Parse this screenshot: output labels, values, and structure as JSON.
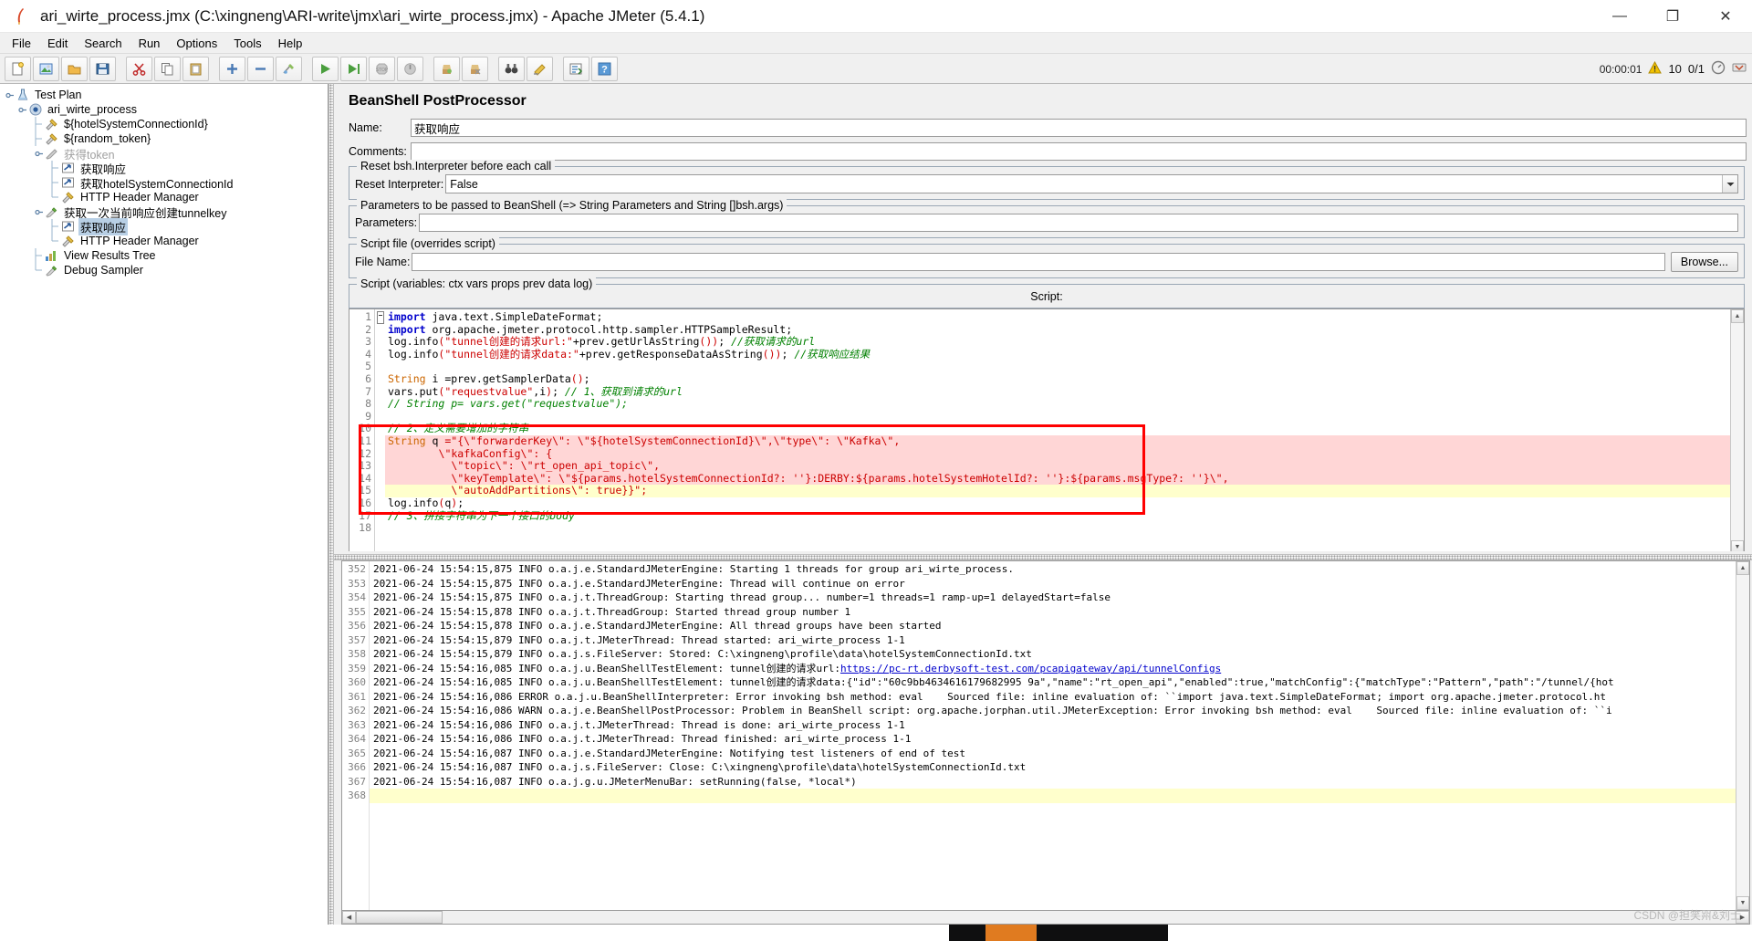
{
  "window": {
    "title": "ari_wirte_process.jmx (C:\\xingneng\\ARI-write\\jmx\\ari_wirte_process.jmx) - Apache JMeter (5.4.1)",
    "app_icon": "jmeter-feather-icon",
    "minimize_label": "—",
    "maximize_label": "❐",
    "close_label": "✕"
  },
  "menu": {
    "items": [
      {
        "label": "File",
        "mnemonic": "F"
      },
      {
        "label": "Edit",
        "mnemonic": "E"
      },
      {
        "label": "Search",
        "mnemonic": "S"
      },
      {
        "label": "Run",
        "mnemonic": "R"
      },
      {
        "label": "Options",
        "mnemonic": "O"
      },
      {
        "label": "Tools",
        "mnemonic": "T"
      },
      {
        "label": "Help",
        "mnemonic": "H"
      }
    ]
  },
  "toolbar": {
    "buttons": [
      {
        "name": "new-button",
        "icon": "new-document-icon",
        "tip": "New"
      },
      {
        "name": "templates-button",
        "icon": "templates-icon",
        "tip": "Templates"
      },
      {
        "name": "open-button",
        "icon": "open-folder-icon",
        "tip": "Open"
      },
      {
        "name": "save-button",
        "icon": "save-disk-icon",
        "tip": "Save"
      },
      {
        "name": "cut-button",
        "icon": "cut-scissors-icon",
        "tip": "Cut"
      },
      {
        "name": "copy-button",
        "icon": "copy-icon",
        "tip": "Copy"
      },
      {
        "name": "paste-button",
        "icon": "paste-clipboard-icon",
        "tip": "Paste"
      },
      {
        "name": "expand-all-button",
        "icon": "plus-expand-icon",
        "tip": "Expand All"
      },
      {
        "name": "collapse-all-button",
        "icon": "minus-collapse-icon",
        "tip": "Collapse All"
      },
      {
        "name": "toggle-button",
        "icon": "toggle-wand-icon",
        "tip": "Toggle"
      },
      {
        "name": "start-button",
        "icon": "play-green-icon",
        "tip": "Start"
      },
      {
        "name": "start-no-pauses-button",
        "icon": "play-no-pause-icon",
        "tip": "Start no pauses"
      },
      {
        "name": "stop-button",
        "icon": "stop-octagon-icon",
        "tip": "Stop"
      },
      {
        "name": "shutdown-button",
        "icon": "shutdown-icon",
        "tip": "Shutdown"
      },
      {
        "name": "clear-button",
        "icon": "clear-broom-icon",
        "tip": "Clear"
      },
      {
        "name": "clear-all-button",
        "icon": "clear-all-icon",
        "tip": "Clear All"
      },
      {
        "name": "search-button",
        "icon": "binoculars-search-icon",
        "tip": "Search"
      },
      {
        "name": "reset-search-button",
        "icon": "reset-search-icon",
        "tip": "Reset Search"
      },
      {
        "name": "function-helper-button",
        "icon": "function-helper-icon",
        "tip": "Function Helper Dialog"
      },
      {
        "name": "help-button",
        "icon": "help-question-icon",
        "tip": "Help"
      }
    ],
    "elapsed_time": "00:00:01",
    "warning_icon": "warning-triangle-icon",
    "warning_count": "10",
    "threads_active": "0/1",
    "threads_icon": "threads-gauge-icon",
    "remote_icon": "remote-engine-icon"
  },
  "tree": {
    "nodes": [
      {
        "label": "Test Plan",
        "icon": "beaker-icon",
        "depth": 0,
        "handle": "expanded",
        "selected": false,
        "dim": false
      },
      {
        "label": "ari_wirte_process",
        "icon": "thread-group-icon",
        "depth": 1,
        "handle": "expanded",
        "selected": false,
        "dim": false
      },
      {
        "label": "${hotelSystemConnectionId}",
        "icon": "config-wrench-icon",
        "depth": 2,
        "handle": "leaf",
        "selected": false,
        "dim": false
      },
      {
        "label": "${random_token}",
        "icon": "config-wrench-icon",
        "depth": 2,
        "handle": "leaf",
        "selected": false,
        "dim": false
      },
      {
        "label": "获得token",
        "icon": "sampler-pen-icon",
        "depth": 2,
        "handle": "expanded",
        "selected": false,
        "dim": true
      },
      {
        "label": "获取响应",
        "icon": "postprocessor-arrow-icon",
        "depth": 3,
        "handle": "leaf",
        "selected": false,
        "dim": false
      },
      {
        "label": "获取hotelSystemConnectionId",
        "icon": "postprocessor-arrow-icon",
        "depth": 3,
        "handle": "leaf",
        "selected": false,
        "dim": false
      },
      {
        "label": "HTTP Header Manager",
        "icon": "config-wrench-icon",
        "depth": 3,
        "handle": "leaf-last",
        "selected": false,
        "dim": false
      },
      {
        "label": "获取一次当前响应创建tunnelkey",
        "icon": "sampler-pen-green-icon",
        "depth": 2,
        "handle": "expanded",
        "selected": false,
        "dim": false
      },
      {
        "label": "获取响应",
        "icon": "postprocessor-arrow-icon",
        "depth": 3,
        "handle": "leaf",
        "selected": true,
        "dim": false
      },
      {
        "label": "HTTP Header Manager",
        "icon": "config-wrench-icon",
        "depth": 3,
        "handle": "leaf-last",
        "selected": false,
        "dim": false
      },
      {
        "label": "View Results Tree",
        "icon": "listener-chart-icon",
        "depth": 2,
        "handle": "leaf",
        "selected": false,
        "dim": false
      },
      {
        "label": "Debug Sampler",
        "icon": "sampler-pen-green-icon",
        "depth": 2,
        "handle": "leaf-last",
        "selected": false,
        "dim": false
      }
    ]
  },
  "editor": {
    "panel_title": "BeanShell PostProcessor",
    "name_label": "Name:",
    "name_value": "获取响应",
    "comments_label": "Comments:",
    "comments_value": "",
    "reset_fieldset_legend": "Reset bsh.Interpreter before each call",
    "reset_label": "Reset Interpreter:",
    "reset_value": "False",
    "reset_options": [
      "False",
      "True"
    ],
    "params_fieldset_legend": "Parameters to be passed to BeanShell (=> String Parameters and String []bsh.args)",
    "params_label": "Parameters:",
    "params_value": "",
    "scriptfile_fieldset_legend": "Script file (overrides script)",
    "filename_label": "File Name:",
    "filename_value": "",
    "browse_label": "Browse...",
    "script_fieldset_legend": "Script (variables: ctx vars props prev data log)",
    "script_center_label": "Script:"
  },
  "script": {
    "lines": [
      {
        "n": 1,
        "fold": true,
        "hl": "none",
        "text": "import java.text.SimpleDateFormat;"
      },
      {
        "n": 2,
        "fold": false,
        "hl": "none",
        "text": "import org.apache.jmeter.protocol.http.sampler.HTTPSampleResult;"
      },
      {
        "n": 3,
        "fold": false,
        "hl": "none",
        "text": "log.info(\"tunnel创建的请求url:\"+prev.getUrlAsString()); //获取请求的url"
      },
      {
        "n": 4,
        "fold": false,
        "hl": "none",
        "text": "log.info(\"tunnel创建的请求data:\"+prev.getResponseDataAsString()); //获取响应结果"
      },
      {
        "n": 5,
        "fold": false,
        "hl": "none",
        "text": ""
      },
      {
        "n": 6,
        "fold": false,
        "hl": "none",
        "text": "String i =prev.getSamplerData();"
      },
      {
        "n": 7,
        "fold": false,
        "hl": "none",
        "text": "vars.put(\"requestvalue\",i); // 1、获取到请求的url"
      },
      {
        "n": 8,
        "fold": false,
        "hl": "none",
        "text": "// String p= vars.get(\"requestvalue\");"
      },
      {
        "n": 9,
        "fold": false,
        "hl": "none",
        "text": ""
      },
      {
        "n": 10,
        "fold": false,
        "hl": "none",
        "text": "// 2、定义需要增加的字符串"
      },
      {
        "n": 11,
        "fold": false,
        "hl": "pink",
        "text": "String q =\"{\\\"forwarderKey\\\": \\\"${hotelSystemConnectionId}\\\",\\\"type\\\": \\\"Kafka\\\","
      },
      {
        "n": 12,
        "fold": false,
        "hl": "pink",
        "text": "        \\\"kafkaConfig\\\": {"
      },
      {
        "n": 13,
        "fold": false,
        "hl": "pink",
        "text": "          \\\"topic\\\": \\\"rt_open_api_topic\\\","
      },
      {
        "n": 14,
        "fold": false,
        "hl": "pink",
        "text": "          \\\"keyTemplate\\\": \\\"${params.hotelSystemConnectionId?: ''}:DERBY:${params.hotelSystemHotelId?: ''}:${params.msgType?: ''}\\\","
      },
      {
        "n": 15,
        "fold": false,
        "hl": "yellow",
        "text": "          \\\"autoAddPartitions\\\": true}}\";"
      },
      {
        "n": 16,
        "fold": false,
        "hl": "none",
        "text": "log.info(q);"
      },
      {
        "n": 17,
        "fold": false,
        "hl": "none",
        "text": "// 3、拼接字符串为下一个接口的body"
      },
      {
        "n": 18,
        "fold": false,
        "hl": "none",
        "text": ""
      }
    ],
    "redbox_note": "red annotation rectangle around lines 10-16"
  },
  "log": {
    "lines": [
      {
        "n": 352,
        "text": "2021-06-24 15:54:15,875 INFO o.a.j.e.StandardJMeterEngine: Starting 1 threads for group ari_wirte_process.",
        "cur": false,
        "clipped_top": true
      },
      {
        "n": 353,
        "text": "2021-06-24 15:54:15,875 INFO o.a.j.e.StandardJMeterEngine: Thread will continue on error",
        "cur": false
      },
      {
        "n": 354,
        "text": "2021-06-24 15:54:15,875 INFO o.a.j.t.ThreadGroup: Starting thread group... number=1 threads=1 ramp-up=1 delayedStart=false",
        "cur": false
      },
      {
        "n": 355,
        "text": "2021-06-24 15:54:15,878 INFO o.a.j.t.ThreadGroup: Started thread group number 1",
        "cur": false
      },
      {
        "n": 356,
        "text": "2021-06-24 15:54:15,878 INFO o.a.j.e.StandardJMeterEngine: All thread groups have been started",
        "cur": false
      },
      {
        "n": 357,
        "text": "2021-06-24 15:54:15,879 INFO o.a.j.t.JMeterThread: Thread started: ari_wirte_process 1-1",
        "cur": false
      },
      {
        "n": 358,
        "text": "2021-06-24 15:54:15,879 INFO o.a.j.s.FileServer: Stored: C:\\xingneng\\profile\\data\\hotelSystemConnectionId.txt",
        "cur": false
      },
      {
        "n": 359,
        "text": "2021-06-24 15:54:16,085 INFO o.a.j.u.BeanShellTestElement: tunnel创建的请求url:",
        "link": "https://pc-rt.derbysoft-test.com/pcapigateway/api/tunnelConfigs",
        "cur": false
      },
      {
        "n": 360,
        "text": "2021-06-24 15:54:16,085 INFO o.a.j.u.BeanShellTestElement: tunnel创建的请求data:{\"id\":\"60c9bb4634616179682995 9a\",\"name\":\"rt_open_api\",\"enabled\":true,\"matchConfig\":{\"matchType\":\"Pattern\",\"path\":\"/tunnel/{hot",
        "cur": false
      },
      {
        "n": 361,
        "text": "2021-06-24 15:54:16,086 ERROR o.a.j.u.BeanShellInterpreter: Error invoking bsh method: eval    Sourced file: inline evaluation of: ``import java.text.SimpleDateFormat; import org.apache.jmeter.protocol.ht",
        "cur": false
      },
      {
        "n": 362,
        "text": "2021-06-24 15:54:16,086 WARN o.a.j.e.BeanShellPostProcessor: Problem in BeanShell script: org.apache.jorphan.util.JMeterException: Error invoking bsh method: eval    Sourced file: inline evaluation of: ``i",
        "cur": false
      },
      {
        "n": 363,
        "text": "2021-06-24 15:54:16,086 INFO o.a.j.t.JMeterThread: Thread is done: ari_wirte_process 1-1",
        "cur": false
      },
      {
        "n": 364,
        "text": "2021-06-24 15:54:16,086 INFO o.a.j.t.JMeterThread: Thread finished: ari_wirte_process 1-1",
        "cur": false
      },
      {
        "n": 365,
        "text": "2021-06-24 15:54:16,087 INFO o.a.j.e.StandardJMeterEngine: Notifying test listeners of end of test",
        "cur": false
      },
      {
        "n": 366,
        "text": "2021-06-24 15:54:16,087 INFO o.a.j.s.FileServer: Close: C:\\xingneng\\profile\\data\\hotelSystemConnectionId.txt",
        "cur": false
      },
      {
        "n": 367,
        "text": "2021-06-24 15:54:16,087 INFO o.a.j.g.u.JMeterMenuBar: setRunning(false, *local*)",
        "cur": false
      },
      {
        "n": 368,
        "text": "",
        "cur": true
      }
    ]
  },
  "watermark": {
    "text": "CSDN @担笑喌&刘士"
  },
  "colors": {
    "accent_red": "#ff0000",
    "highlight_pink": "#ffd6d6",
    "highlight_yellow": "#ffffcc",
    "selection_blue": "#b8cfe5",
    "keyword_blue": "#0000cc",
    "string_red": "#cc0000",
    "comment_green": "#008000",
    "type_orange": "#cc6600"
  }
}
